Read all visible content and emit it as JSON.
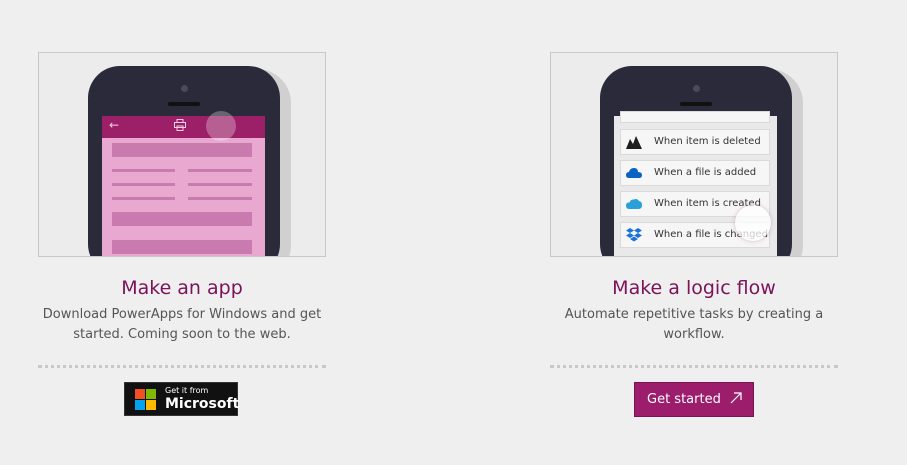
{
  "app_card": {
    "title": "Make an app",
    "description": "Download PowerApps for Windows and get started. Coming soon to the web.",
    "badge_small": "Get it from",
    "badge_big": "Microsoft",
    "illustration": {
      "appbar_back_icon": "back-arrow-icon",
      "appbar_print_icon": "printer-icon"
    }
  },
  "flow_card": {
    "title": "Make a logic flow",
    "description": "Automate repetitive tasks by creating a workflow.",
    "button_label": "Get started",
    "button_icon": "external-arrow-icon",
    "flow_items": [
      {
        "label": "When item is deleted",
        "icon": "sharepoint-icon"
      },
      {
        "label": "When a file is added",
        "icon": "onedrive-cloud-icon"
      },
      {
        "label": "When item is created",
        "icon": "salesforce-cloud-icon"
      },
      {
        "label": "When a file is changed",
        "icon": "dropbox-icon"
      }
    ]
  },
  "colors": {
    "accent": "#9b1d6c",
    "title": "#7a1359",
    "background": "#efefef"
  }
}
